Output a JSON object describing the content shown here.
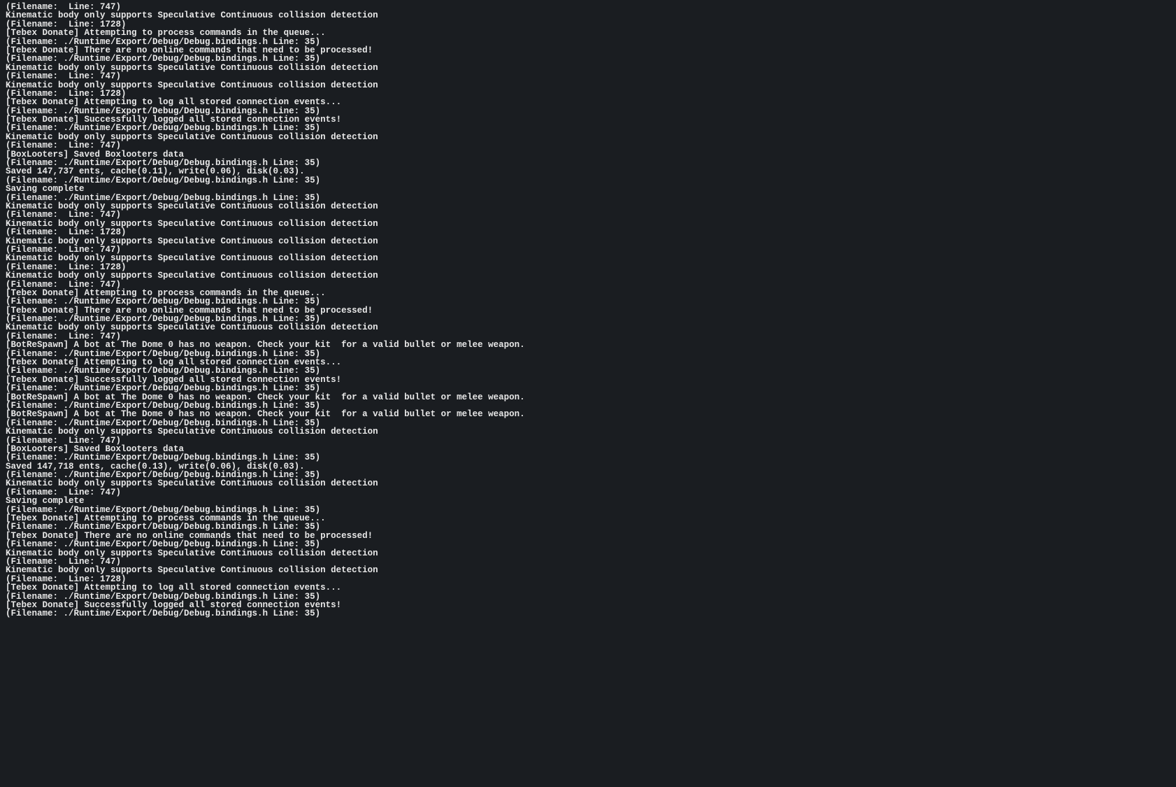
{
  "console": {
    "lines": [
      "(Filename:  Line: 747)",
      "Kinematic body only supports Speculative Continuous collision detection",
      "(Filename:  Line: 1728)",
      "[Tebex Donate] Attempting to process commands in the queue...",
      "(Filename: ./Runtime/Export/Debug/Debug.bindings.h Line: 35)",
      "[Tebex Donate] There are no online commands that need to be processed!",
      "(Filename: ./Runtime/Export/Debug/Debug.bindings.h Line: 35)",
      "Kinematic body only supports Speculative Continuous collision detection",
      "(Filename:  Line: 747)",
      "Kinematic body only supports Speculative Continuous collision detection",
      "(Filename:  Line: 1728)",
      "[Tebex Donate] Attempting to log all stored connection events...",
      "(Filename: ./Runtime/Export/Debug/Debug.bindings.h Line: 35)",
      "[Tebex Donate] Successfully logged all stored connection events!",
      "(Filename: ./Runtime/Export/Debug/Debug.bindings.h Line: 35)",
      "Kinematic body only supports Speculative Continuous collision detection",
      "(Filename:  Line: 747)",
      "[BoxLooters] Saved Boxlooters data",
      "(Filename: ./Runtime/Export/Debug/Debug.bindings.h Line: 35)",
      "Saved 147,737 ents, cache(0.11), write(0.06), disk(0.03).",
      "(Filename: ./Runtime/Export/Debug/Debug.bindings.h Line: 35)",
      "Saving complete",
      "(Filename: ./Runtime/Export/Debug/Debug.bindings.h Line: 35)",
      "Kinematic body only supports Speculative Continuous collision detection",
      "(Filename:  Line: 747)",
      "Kinematic body only supports Speculative Continuous collision detection",
      "(Filename:  Line: 1728)",
      "Kinematic body only supports Speculative Continuous collision detection",
      "(Filename:  Line: 747)",
      "Kinematic body only supports Speculative Continuous collision detection",
      "(Filename:  Line: 1728)",
      "Kinematic body only supports Speculative Continuous collision detection",
      "(Filename:  Line: 747)",
      "[Tebex Donate] Attempting to process commands in the queue...",
      "(Filename: ./Runtime/Export/Debug/Debug.bindings.h Line: 35)",
      "[Tebex Donate] There are no online commands that need to be processed!",
      "(Filename: ./Runtime/Export/Debug/Debug.bindings.h Line: 35)",
      "Kinematic body only supports Speculative Continuous collision detection",
      "(Filename:  Line: 747)",
      "[BotReSpawn] A bot at The Dome 0 has no weapon. Check your kit  for a valid bullet or melee weapon.",
      "(Filename: ./Runtime/Export/Debug/Debug.bindings.h Line: 35)",
      "[Tebex Donate] Attempting to log all stored connection events...",
      "(Filename: ./Runtime/Export/Debug/Debug.bindings.h Line: 35)",
      "[Tebex Donate] Successfully logged all stored connection events!",
      "(Filename: ./Runtime/Export/Debug/Debug.bindings.h Line: 35)",
      "[BotReSpawn] A bot at The Dome 0 has no weapon. Check your kit  for a valid bullet or melee weapon.",
      "(Filename: ./Runtime/Export/Debug/Debug.bindings.h Line: 35)",
      "[BotReSpawn] A bot at The Dome 0 has no weapon. Check your kit  for a valid bullet or melee weapon.",
      "(Filename: ./Runtime/Export/Debug/Debug.bindings.h Line: 35)",
      "Kinematic body only supports Speculative Continuous collision detection",
      "(Filename:  Line: 747)",
      "[BoxLooters] Saved Boxlooters data",
      "(Filename: ./Runtime/Export/Debug/Debug.bindings.h Line: 35)",
      "Saved 147,718 ents, cache(0.13), write(0.06), disk(0.03).",
      "(Filename: ./Runtime/Export/Debug/Debug.bindings.h Line: 35)",
      "Kinematic body only supports Speculative Continuous collision detection",
      "(Filename:  Line: 747)",
      "Saving complete",
      "(Filename: ./Runtime/Export/Debug/Debug.bindings.h Line: 35)",
      "[Tebex Donate] Attempting to process commands in the queue...",
      "(Filename: ./Runtime/Export/Debug/Debug.bindings.h Line: 35)",
      "[Tebex Donate] There are no online commands that need to be processed!",
      "(Filename: ./Runtime/Export/Debug/Debug.bindings.h Line: 35)",
      "Kinematic body only supports Speculative Continuous collision detection",
      "(Filename:  Line: 747)",
      "Kinematic body only supports Speculative Continuous collision detection",
      "(Filename:  Line: 1728)",
      "[Tebex Donate] Attempting to log all stored connection events...",
      "(Filename: ./Runtime/Export/Debug/Debug.bindings.h Line: 35)",
      "[Tebex Donate] Successfully logged all stored connection events!",
      "(Filename: ./Runtime/Export/Debug/Debug.bindings.h Line: 35)"
    ]
  }
}
